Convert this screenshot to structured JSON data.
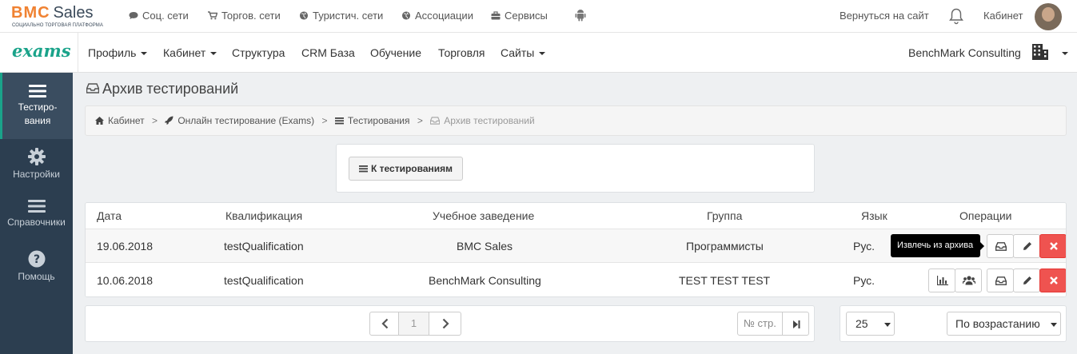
{
  "brand": {
    "logo_bmc": "BMC",
    "logo_sales": "Sales",
    "logo_tagline": "СОЦИАЛЬНО ТОРГОВАЯ ПЛАТФОРМА",
    "app_name": "exams"
  },
  "topnav": [
    {
      "label": "Соц. сети",
      "icon": "chat-icon"
    },
    {
      "label": "Торгов. сети",
      "icon": "cart-icon"
    },
    {
      "label": "Туристич. сети",
      "icon": "globe-icon"
    },
    {
      "label": "Ассоциации",
      "icon": "globe-icon"
    },
    {
      "label": "Сервисы",
      "icon": "briefcase-icon"
    }
  ],
  "top_right": {
    "back_label": "Вернуться на сайт",
    "cabinet_label": "Кабинет"
  },
  "mainnav": {
    "items": [
      {
        "label": "Профиль",
        "dropdown": true
      },
      {
        "label": "Кабинет",
        "dropdown": true
      },
      {
        "label": "Структура",
        "dropdown": false
      },
      {
        "label": "CRM База",
        "dropdown": false
      },
      {
        "label": "Обучение",
        "dropdown": false
      },
      {
        "label": "Торговля",
        "dropdown": false
      },
      {
        "label": "Сайты",
        "dropdown": true
      }
    ],
    "company": "BenchMark Consulting"
  },
  "sidebar": [
    {
      "label": "Тестиро-\nвания",
      "icon": "menu-icon",
      "active": true
    },
    {
      "label": "Настройки",
      "icon": "gear-icon",
      "active": false
    },
    {
      "label": "Справочники",
      "icon": "menu-icon",
      "active": false
    },
    {
      "label": "Помощь",
      "icon": "help-icon",
      "active": false
    }
  ],
  "page": {
    "title": "Архив тестирований"
  },
  "breadcrumb": [
    "Кабинет",
    "Онлайн тестирование (Exams)",
    "Тестирования",
    "Архив тестирований"
  ],
  "actions": {
    "back_button": "К тестированиям"
  },
  "table": {
    "headers": [
      "Дата",
      "Квалификация",
      "Учебное заведение",
      "Группа",
      "Язык",
      "Операции"
    ],
    "rows": [
      {
        "date": "19.06.2018",
        "qualification": "testQualification",
        "institution": "BMC Sales",
        "group": "Программисты",
        "lang": "Рус."
      },
      {
        "date": "10.06.2018",
        "qualification": "testQualification",
        "institution": "BenchMark Consulting",
        "group": "TEST TEST TEST",
        "lang": "Рус."
      }
    ],
    "tooltip": "Извлечь из архива"
  },
  "pagination": {
    "current_page": "1",
    "page_input_placeholder": "№ стр.",
    "page_size": "25",
    "sort": "По возрастанию"
  },
  "colors": {
    "accent": "#1aa38a",
    "sidebar_bg": "#2c3e50",
    "danger": "#ef5350",
    "logo_orange": "#f08232"
  }
}
